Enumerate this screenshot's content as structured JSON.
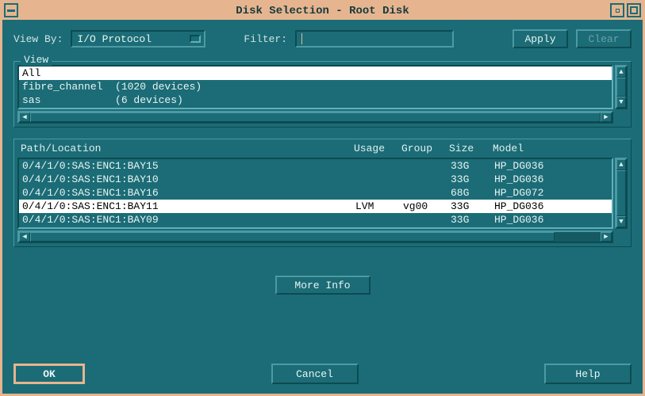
{
  "window": {
    "title": "Disk Selection - Root Disk"
  },
  "controls": {
    "view_by_label": "View By:",
    "view_by_value": "I/O Protocol",
    "filter_label": "Filter:",
    "filter_value": "",
    "apply_label": "Apply",
    "clear_label": "Clear"
  },
  "view_group": {
    "title": "View",
    "items": [
      {
        "text": "All",
        "selected": true
      },
      {
        "text": "fibre_channel  (1020 devices)",
        "selected": false
      },
      {
        "text": "sas            (6 devices)",
        "selected": false
      }
    ]
  },
  "table": {
    "headers": {
      "path": "Path/Location",
      "usage": "Usage",
      "group": "Group",
      "size": "Size",
      "model": "Model"
    },
    "rows": [
      {
        "path": "0/4/1/0:SAS:ENC1:BAY15",
        "usage": "",
        "group": "",
        "size": "33G",
        "model": "HP_DG036",
        "selected": false
      },
      {
        "path": "0/4/1/0:SAS:ENC1:BAY10",
        "usage": "",
        "group": "",
        "size": "33G",
        "model": "HP_DG036",
        "selected": false
      },
      {
        "path": "0/4/1/0:SAS:ENC1:BAY16",
        "usage": "",
        "group": "",
        "size": "68G",
        "model": "HP_DG072",
        "selected": false
      },
      {
        "path": "0/4/1/0:SAS:ENC1:BAY11",
        "usage": "LVM",
        "group": "vg00",
        "size": "33G",
        "model": "HP_DG036",
        "selected": true
      },
      {
        "path": "0/4/1/0:SAS:ENC1:BAY09",
        "usage": "",
        "group": "",
        "size": "33G",
        "model": "HP_DG036",
        "selected": false
      }
    ]
  },
  "buttons": {
    "more_info": "More Info",
    "ok": "OK",
    "cancel": "Cancel",
    "help": "Help"
  }
}
